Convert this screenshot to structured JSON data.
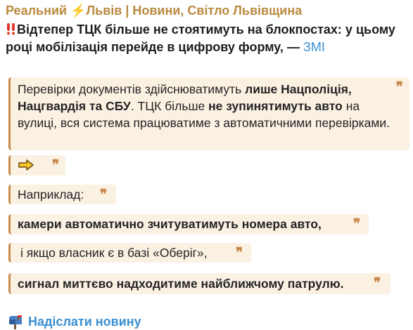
{
  "channel": {
    "title": "Реальний ⚡Львів | Новини, Світло Львівщина"
  },
  "headline": {
    "icon": "double-exclamation-icon",
    "text": "Відтепер ТЦК більше не стоятимуть на блокпостах: у цьому році мобілізація перейде в цифрову форму, — ",
    "source": "ЗМІ"
  },
  "quotes": {
    "q1": {
      "t1": "Перевірки документів здійснюватимуть ",
      "b1": "лише Нацполіція, Нацгвардія та СБУ",
      "t2": ". ТЦК більше ",
      "b2": "не зупинятимуть авто",
      "t3": " на вулиці, вся система працюватиме з автоматичними перевірками."
    },
    "q2": {
      "icon": "right-arrow-emoji-icon"
    },
    "q3": {
      "text": "Наприклад:"
    },
    "q4": {
      "text": "камери автоматично зчитуватимуть номера авто,"
    },
    "q5": {
      "text": "і якщо власник є в базі «Оберіг»,"
    },
    "q6": {
      "text": "сигнал миттєво надходитиме найближчому патрулю."
    },
    "mark": "❞"
  },
  "footer": {
    "icon": "mailbox-icon",
    "link": "Надіслати новину"
  },
  "colors": {
    "accent_gold": "#b98a3f",
    "link_blue": "#3a8fd0",
    "quote_bg": "#fbf1e3",
    "quote_bar": "#c8894a"
  }
}
